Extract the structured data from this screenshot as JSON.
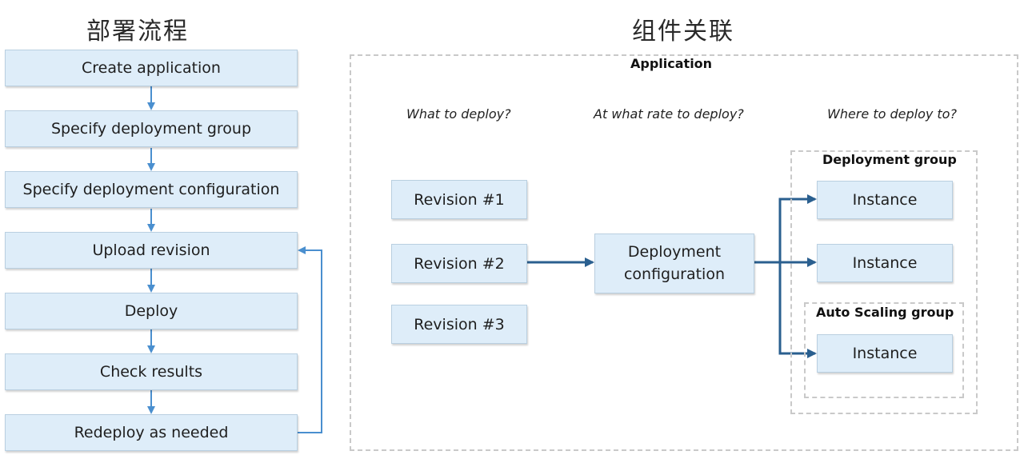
{
  "left": {
    "heading": "部署流程",
    "steps": [
      "Create application",
      "Specify deployment group",
      "Specify deployment configuration",
      "Upload revision",
      "Deploy",
      "Check results",
      "Redeploy as needed"
    ],
    "loop": {
      "from": "Redeploy as needed",
      "to": "Upload revision"
    }
  },
  "right": {
    "heading": "组件关联",
    "application_label": "Application",
    "questions": {
      "what": "What to deploy?",
      "rate": "At what rate to deploy?",
      "where": "Where to deploy to?"
    },
    "revisions": [
      "Revision #1",
      "Revision #2",
      "Revision #3"
    ],
    "deployment_configuration": "Deployment configuration",
    "deployment_group_label": "Deployment group",
    "auto_scaling_group_label": "Auto Scaling group",
    "instances": [
      "Instance",
      "Instance",
      "Instance"
    ]
  },
  "colors": {
    "box_fill": "#deedf9",
    "left_arrow": "#4a8fcf",
    "right_arrow": "#2a5f8f",
    "dashed_border": "#c9c9c9"
  }
}
